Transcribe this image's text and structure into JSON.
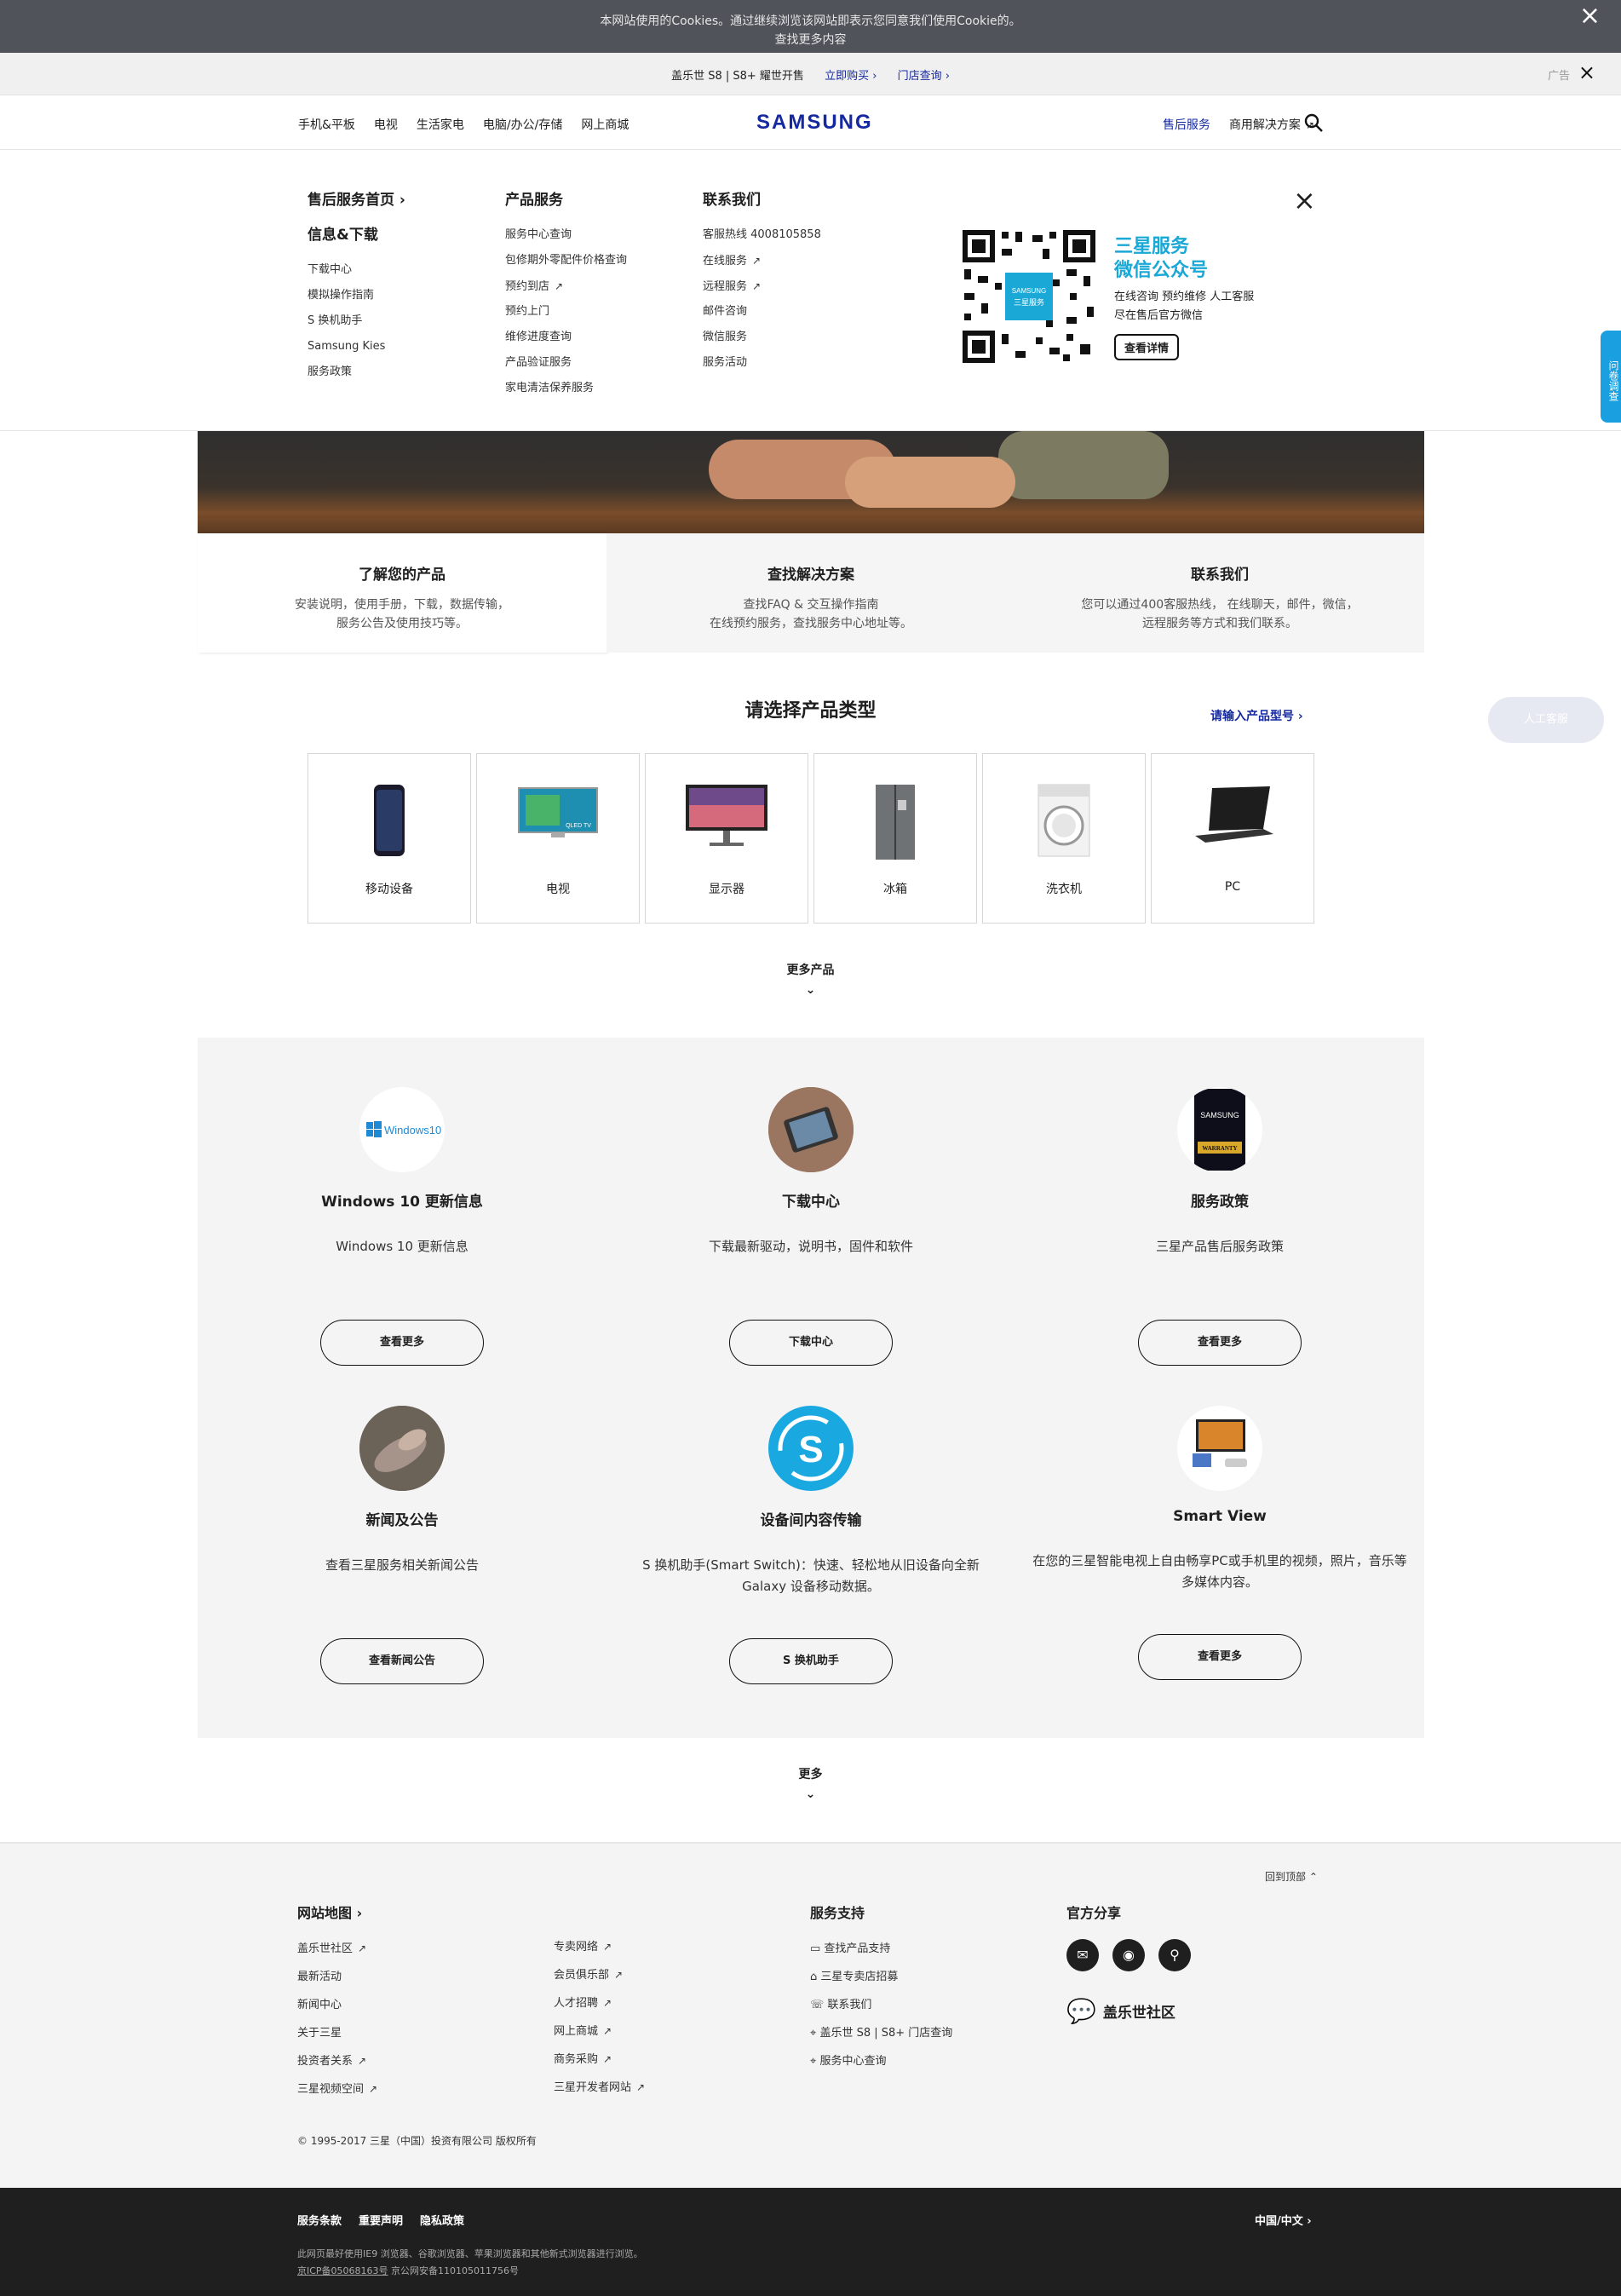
{
  "cookie": {
    "line1": "本网站使用的Cookies。通过继续浏览该网站即表示您同意我们使用Cookie的。",
    "line2": "查找更多内容",
    "close_icon": "close-icon"
  },
  "promo": {
    "text": "盖乐世 S8 | S8+ 耀世开售",
    "buy": "立即购买",
    "store": "门店查询",
    "ad": "广告"
  },
  "nav": {
    "left": [
      "手机&平板",
      "电视",
      "生活家电",
      "电脑/办公/存储",
      "网上商城"
    ],
    "logo": "SAMSUNG",
    "right": [
      "售后服务",
      "商用解决方案"
    ],
    "search_icon": "search-icon"
  },
  "mega": {
    "col1": {
      "home": "售后服务首页",
      "heading": "信息&下载",
      "items": [
        "下载中心",
        "模拟操作指南",
        "S 换机助手",
        "Samsung Kies",
        "服务政策"
      ]
    },
    "col2": {
      "heading": "产品服务",
      "items": [
        "服务中心查询",
        "包修期外零配件价格查询",
        "预约到店",
        "预约上门",
        "维修进度查询",
        "产品验证服务",
        "家电清洁保养服务"
      ]
    },
    "col3": {
      "heading": "联系我们",
      "items": [
        "客服热线 4008105858",
        "在线服务",
        "远程服务",
        "邮件咨询",
        "微信服务",
        "服务活动"
      ]
    },
    "wechat": {
      "title1": "三星服务",
      "title2": "微信公众号",
      "line1": "在线咨询  预约维修  人工客服",
      "line2": "尽在售后官方微信",
      "button": "查看详情",
      "qr_label": "SAMSUNG 三星服务"
    }
  },
  "sidetab": "问卷调查",
  "tabs": [
    {
      "title": "了解您的产品",
      "line1": "安装说明，使用手册，下载，数据传输，",
      "line2": "服务公告及使用技巧等。"
    },
    {
      "title": "查找解决方案",
      "line1": "查找FAQ & 交互操作指南",
      "line2": "在线预约服务，查找服务中心地址等。"
    },
    {
      "title": "联系我们",
      "line1": "您可以通过400客服热线， 在线聊天，邮件，微信，",
      "line2": "远程服务等方式和我们联系。"
    }
  ],
  "selection": {
    "title": "请选择产品类型",
    "link": "请输入产品型号",
    "products": [
      "移动设备",
      "电视",
      "显示器",
      "冰箱",
      "洗衣机",
      "PC"
    ],
    "more": "更多产品",
    "tv_badge": "QLED TV"
  },
  "chat": "人工客服",
  "cards": [
    {
      "title": "Windows 10 更新信息",
      "desc": "Windows 10 更新信息",
      "button": "查看更多",
      "icon_text": "Windows10"
    },
    {
      "title": "下载中心",
      "desc": "下载最新驱动，说明书，固件和软件",
      "button": "下载中心"
    },
    {
      "title": "服务政策",
      "desc": "三星产品售后服务政策",
      "button": "查看更多",
      "icon_text": "SAMSUNG",
      "icon_sub": "WARRANTY"
    },
    {
      "title": "新闻及公告",
      "desc": "查看三星服务相关新闻公告",
      "button": "查看新闻公告"
    },
    {
      "title": "设备间内容传输",
      "desc": "S 换机助手(Smart Switch)：快速、轻松地从旧设备向全新 Galaxy 设备移动数据。",
      "button": "S 换机助手",
      "icon_text": "S"
    },
    {
      "title": "Smart View",
      "desc": "在您的三星智能电视上自由畅享PC或手机里的视频，照片，音乐等多媒体内容。",
      "button": "查看更多"
    }
  ],
  "more2": "更多",
  "footer": {
    "totop": "回到顶部",
    "sitemap": "网站地图",
    "col_a": [
      "盖乐世社区",
      "最新活动",
      "新闻中心",
      "关于三星",
      "投资者关系",
      "三星视频空间"
    ],
    "col_b": [
      "专卖网络",
      "会员俱乐部",
      "人才招聘",
      "网上商城",
      "商务采购",
      "三星开发者网站"
    ],
    "support": "服务支持",
    "support_items": [
      "查找产品支持",
      "三星专卖店招募",
      "联系我们",
      "盖乐世 S8 | S8+ 门店查询",
      "服务中心查询"
    ],
    "share": "官方分享",
    "community": "盖乐世社区",
    "copyright": "© 1995-2017 三星（中国）投资有限公司 版权所有"
  },
  "bottom": {
    "links": [
      "服务条款",
      "重要声明",
      "隐私政策"
    ],
    "region": "中国/中文",
    "note1": "此网页最好使用IE9 浏览器、谷歌浏览器、苹果浏览器和其他新式浏览器进行浏览。",
    "icp": "京ICP备05068163号",
    "police": "京公网安备110105011756号"
  }
}
